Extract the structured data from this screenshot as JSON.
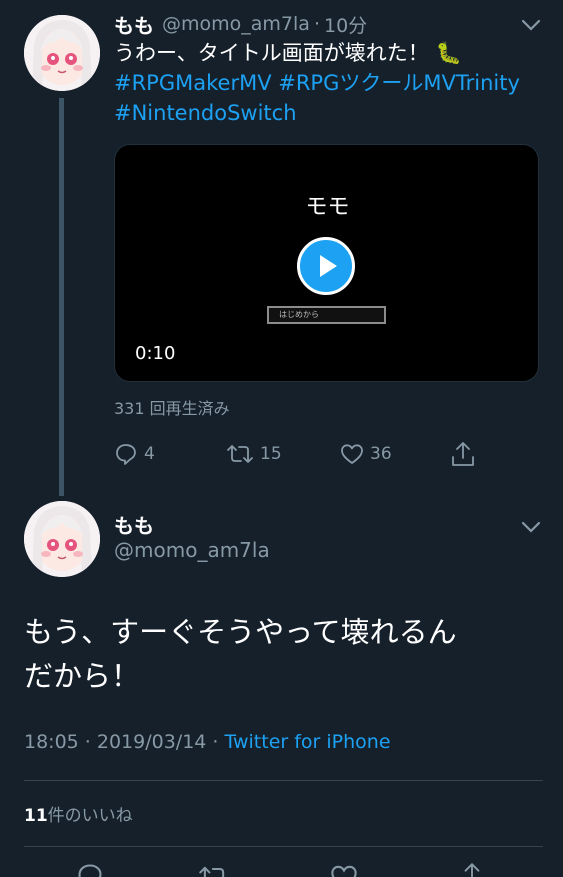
{
  "tweet1": {
    "name": "もも",
    "handle": "@momo_am7la",
    "dot": "·",
    "time": "10分",
    "text": "うわー、タイトル画面が壊れた！",
    "emoji": "🐛",
    "hashtag1": "#RPGMakerMV",
    "hashtag2": "#RPGツクールMVTrinity",
    "hashtag3": "#NintendoSwitch",
    "video": {
      "title": "モモ",
      "duration": "0:10",
      "menu_text": "はじめから"
    },
    "views": "331 回再生済み",
    "actions": {
      "replies": "4",
      "retweets": "15",
      "likes": "36"
    }
  },
  "tweet2": {
    "name": "もも",
    "handle": "@momo_am7la",
    "text_line1": "もう、すーぐそうやって壊れるん",
    "text_line2": "だから！",
    "timestamp": "18:05 · 2019/03/14 · ",
    "source": "Twitter for iPhone",
    "likes_count": "11",
    "likes_label": "件のいいね"
  },
  "colors": {
    "background": "#15202b",
    "accent": "#1da1f2",
    "muted": "#8899a6",
    "divider": "#38444d"
  },
  "icons": [
    "chevron-down-icon",
    "reply-icon",
    "retweet-icon",
    "like-icon",
    "share-icon",
    "play-icon"
  ]
}
